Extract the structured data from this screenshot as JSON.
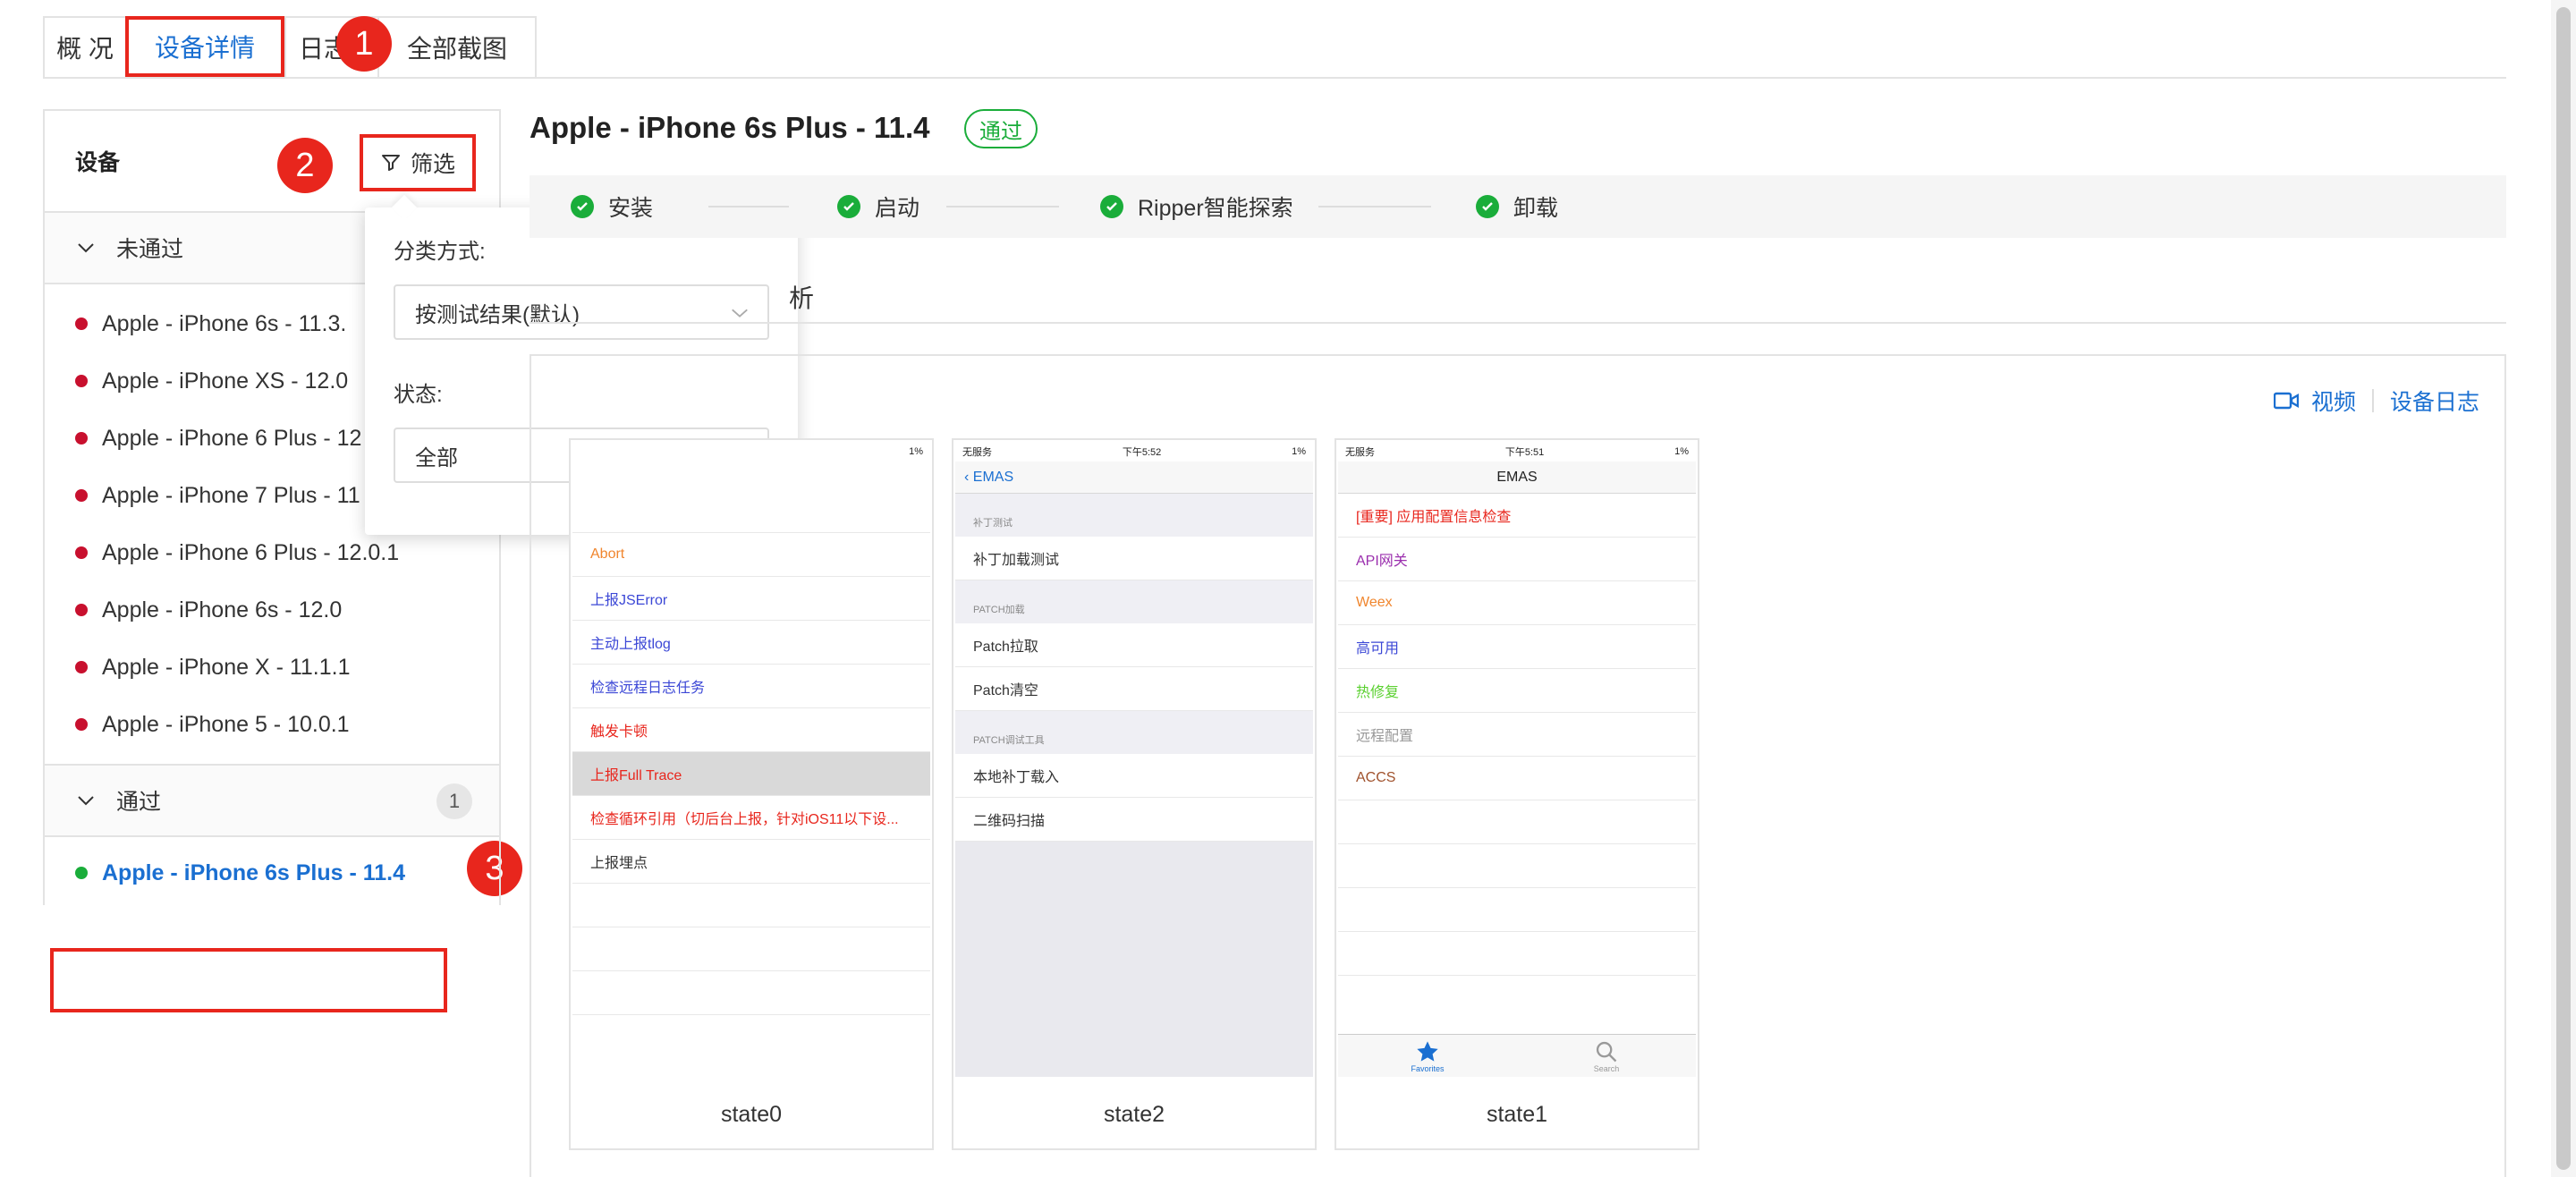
{
  "tabs": [
    "概 况",
    "设备详情",
    "日志",
    "全部截图"
  ],
  "markers": [
    "1",
    "2",
    "3"
  ],
  "sidebar": {
    "header": "设备",
    "filter_label": "筛选",
    "failed_group": {
      "label": "未通过"
    },
    "failed_devices": [
      "Apple - iPhone 6s - 11.3.",
      "Apple - iPhone XS - 12.0",
      "Apple - iPhone 6 Plus - 12",
      "Apple - iPhone 7 Plus - 11",
      "Apple - iPhone 6 Plus - 12.0.1",
      "Apple - iPhone 6s - 12.0",
      "Apple - iPhone X - 11.1.1",
      "Apple - iPhone 5 - 10.0.1"
    ],
    "passed_group": {
      "label": "通过",
      "count": "1"
    },
    "passed_devices": [
      "Apple - iPhone 6s Plus - 11.4"
    ]
  },
  "popup": {
    "sort_label": "分类方式:",
    "sort_value": "按测试结果(默认)",
    "status_label": "状态:",
    "status_value": "全部"
  },
  "main": {
    "title": "Apple - iPhone 6s Plus - 11.4",
    "badge": "通过",
    "steps": [
      "安装",
      "启动",
      "Ripper智能探索",
      "卸载"
    ],
    "subtab": "析",
    "video_link": "视频",
    "log_link": "设备日志"
  },
  "cards": [
    {
      "caption": "state0",
      "status_right": "1%",
      "rows": [
        {
          "text": "Abort",
          "color": "#f0852d"
        },
        {
          "text": "上报JSError",
          "color": "#3b47d6"
        },
        {
          "text": "主动上报tlog",
          "color": "#3b47d6"
        },
        {
          "text": "检查远程日志任务",
          "color": "#3b47d6"
        },
        {
          "text": "触发卡顿",
          "color": "#e8261d"
        },
        {
          "text": "上报Full Trace",
          "color": "#e8261d"
        },
        {
          "text": "检查循环引用（切后台上报，针对iOS11以下设...",
          "color": "#e8261d"
        },
        {
          "text": "上报埋点",
          "color": "#333333"
        }
      ]
    },
    {
      "caption": "state2",
      "status_left": "无服务",
      "status_time": "下午5:52",
      "status_right": "1%",
      "nav_back": "EMAS",
      "sections": [
        {
          "header": "补丁测试",
          "rows": [
            "补丁加载测试"
          ]
        },
        {
          "header": "PATCH加载",
          "rows": [
            "Patch拉取",
            "Patch清空"
          ]
        },
        {
          "header": "PATCH调试工具",
          "rows": [
            "本地补丁载入",
            "二维码扫描"
          ]
        }
      ]
    },
    {
      "caption": "state1",
      "status_left": "无服务",
      "status_time": "下午5:51",
      "status_right": "1%",
      "nav_title": "EMAS",
      "rows": [
        {
          "text": "[重要] 应用配置信息检查",
          "color": "#e8261d"
        },
        {
          "text": "API网关",
          "color": "#9b2fae"
        },
        {
          "text": "Weex",
          "color": "#f0852d"
        },
        {
          "text": "高可用",
          "color": "#3b47d6"
        },
        {
          "text": "热修复",
          "color": "#5ad02f"
        },
        {
          "text": "远程配置",
          "color": "#999999"
        },
        {
          "text": "ACCS",
          "color": "#a0522d"
        }
      ],
      "tabbar": [
        "Favorites",
        "Search"
      ]
    }
  ],
  "colors": {
    "accent": "#1a6fd1",
    "highlight": "#e8261d",
    "pass": "#1aad3a",
    "fail": "#c8102e"
  }
}
